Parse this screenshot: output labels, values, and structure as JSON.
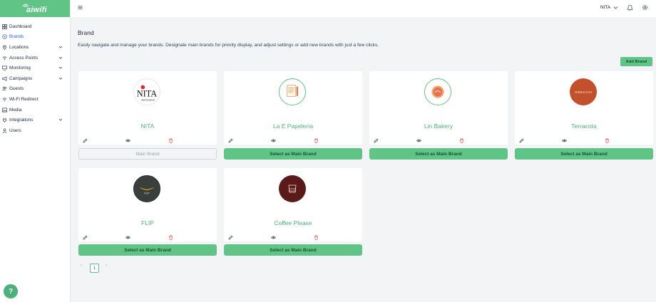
{
  "app": {
    "logo_text": "aiwifi"
  },
  "sidebar": {
    "items": [
      {
        "label": "Dashboard",
        "icon": "grid-icon",
        "expandable": false
      },
      {
        "label": "Brands",
        "icon": "brand-icon",
        "expandable": false,
        "active": true
      },
      {
        "label": "Locations",
        "icon": "pin-icon",
        "expandable": true
      },
      {
        "label": "Access Points",
        "icon": "wifi-icon",
        "expandable": true
      },
      {
        "label": "Monitoring",
        "icon": "monitor-icon",
        "expandable": true
      },
      {
        "label": "Campaigns",
        "icon": "megaphone-icon",
        "expandable": true
      },
      {
        "label": "Guests",
        "icon": "users-icon",
        "expandable": false
      },
      {
        "label": "Wi-Fi Redirect",
        "icon": "redirect-icon",
        "expandable": false
      },
      {
        "label": "Media",
        "icon": "image-icon",
        "expandable": false
      },
      {
        "label": "Integrations",
        "icon": "plug-icon",
        "expandable": true
      },
      {
        "label": "Users",
        "icon": "user-icon",
        "expandable": false
      }
    ]
  },
  "topbar": {
    "user_name": "NITA"
  },
  "help": {
    "label": "?"
  },
  "page": {
    "title": "Brand",
    "description": "Easily navigate and manage your brands. Designate main brands for priority display, and adjust settings or add new brands with just a few clicks.",
    "add_brand_label": "Add Brand"
  },
  "brands": [
    {
      "name": "NITA",
      "button_label": "Main Brand",
      "is_main": true,
      "logo_text": "NITA",
      "logo_sub": "RESTAURANT"
    },
    {
      "name": "La E Papelería",
      "button_label": "Select as Main Brand",
      "is_main": false
    },
    {
      "name": "Lin Bakery",
      "button_label": "Select as Main Brand",
      "is_main": false
    },
    {
      "name": "Terracota",
      "button_label": "Select as Main Brand",
      "is_main": false,
      "logo_text": "TERRACOTA"
    },
    {
      "name": "FLIP",
      "button_label": "Select as Main Brand",
      "is_main": false,
      "logo_text": "FLIP"
    },
    {
      "name": "Coffee Please",
      "button_label": "Select as Main Brand",
      "is_main": false,
      "logo_text": "COFFEE PLEASE"
    }
  ],
  "pagination": {
    "prev": "‹",
    "current": "1",
    "next": "›"
  },
  "colors": {
    "primary": "#5fc485",
    "brand_name": "#4cb07a",
    "delete": "#ef4444",
    "active_nav": "#2563eb"
  }
}
